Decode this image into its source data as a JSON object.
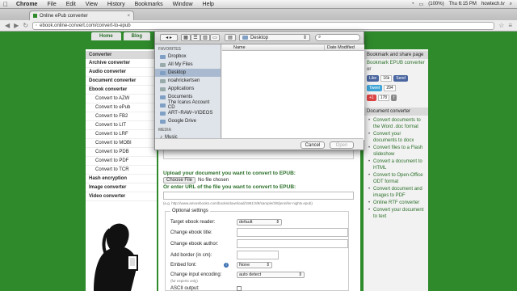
{
  "menubar": {
    "app": "Chrome",
    "items": [
      "File",
      "Edit",
      "View",
      "History",
      "Bookmarks",
      "Window",
      "Help"
    ],
    "battery": "(100%)",
    "clock": "Thu 6:15 PM",
    "user": "howtech.tv"
  },
  "browser": {
    "tab_title": "Online ePub converter",
    "url": "ebook.online-convert.com/convert-to-epub"
  },
  "topnav": [
    "Home",
    "Blog"
  ],
  "left": {
    "header": "Converter",
    "items": [
      {
        "label": "Archive converter",
        "sub": false
      },
      {
        "label": "Audio converter",
        "sub": false
      },
      {
        "label": "Document converter",
        "sub": false
      },
      {
        "label": "Ebook converter",
        "sub": false
      },
      {
        "label": "Convert to AZW",
        "sub": true
      },
      {
        "label": "Convert to ePub",
        "sub": true
      },
      {
        "label": "Convert to FB2",
        "sub": true
      },
      {
        "label": "Convert to LIT",
        "sub": true
      },
      {
        "label": "Convert to LRF",
        "sub": true
      },
      {
        "label": "Convert to MOBI",
        "sub": true
      },
      {
        "label": "Convert to PDB",
        "sub": true
      },
      {
        "label": "Convert to PDF",
        "sub": true
      },
      {
        "label": "Convert to TCR",
        "sub": true
      },
      {
        "label": "Hash encryption",
        "sub": false
      },
      {
        "label": "Image converter",
        "sub": false
      },
      {
        "label": "Video converter",
        "sub": false
      }
    ]
  },
  "center": {
    "upload_label": "Upload your document you want to convert to EPUB:",
    "choose_label": "Choose File",
    "no_file": "No file chosen",
    "url_label": "Or enter URL of the file you want to convert to EPUB:",
    "example": "(e.g. http://www.amorebooks.com/books/download/1951/3/8/sample/3/8/jennifer-nights.epub)",
    "options_legend": "Optional settings",
    "options": [
      {
        "label": "Target ebook reader:",
        "type": "select",
        "value": "default"
      },
      {
        "label": "Change ebook title:",
        "type": "text",
        "value": ""
      },
      {
        "label": "Change ebook author:",
        "type": "text",
        "value": ""
      },
      {
        "label": "Add border (in cm):",
        "type": "text",
        "value": ""
      },
      {
        "label": "Embed font:",
        "type": "select",
        "value": "None"
      },
      {
        "label": "Change input encoding:",
        "type": "select",
        "value": "auto detect"
      }
    ],
    "encoding_note": "(for experts only)",
    "ascii_label": "ASCII output:"
  },
  "right": {
    "bookmark_header": "Bookmark and share page",
    "bookmark_text": "Bookmark EPUB converter",
    "or": "or",
    "like": "Like",
    "like_count": "16k",
    "send": "Send",
    "tweet": "Tweet",
    "tweet_count": "294",
    "plus_count": "178",
    "doc_header": "Document converter",
    "doc_links": [
      "Convert documents to the Word .doc format",
      "Convert your documents to docx",
      "Convert files to a Flash slideshow",
      "Convert a document to HTML",
      "Convert to Open-Office ODT format",
      "Convert document and images to PDF",
      "Online RTF converter",
      "Convert your document to text"
    ]
  },
  "dialog": {
    "location": "Desktop",
    "search_placeholder": "",
    "col_name": "Name",
    "col_date": "Date Modified",
    "favorites_header": "FAVORITES",
    "favorites": [
      "Dropbox",
      "All My Files",
      "Desktop",
      "noahrickertsen",
      "Applications",
      "Documents",
      "The Icarus Account CD",
      "ART~RAW~VIDEOS",
      "Google Drive"
    ],
    "selected_index": 2,
    "media_header": "MEDIA",
    "media": [
      "Music"
    ],
    "cancel": "Cancel",
    "open": "Open"
  },
  "colors": {
    "brand_green": "#2f8a2c",
    "link_green": "#2a6f28"
  }
}
